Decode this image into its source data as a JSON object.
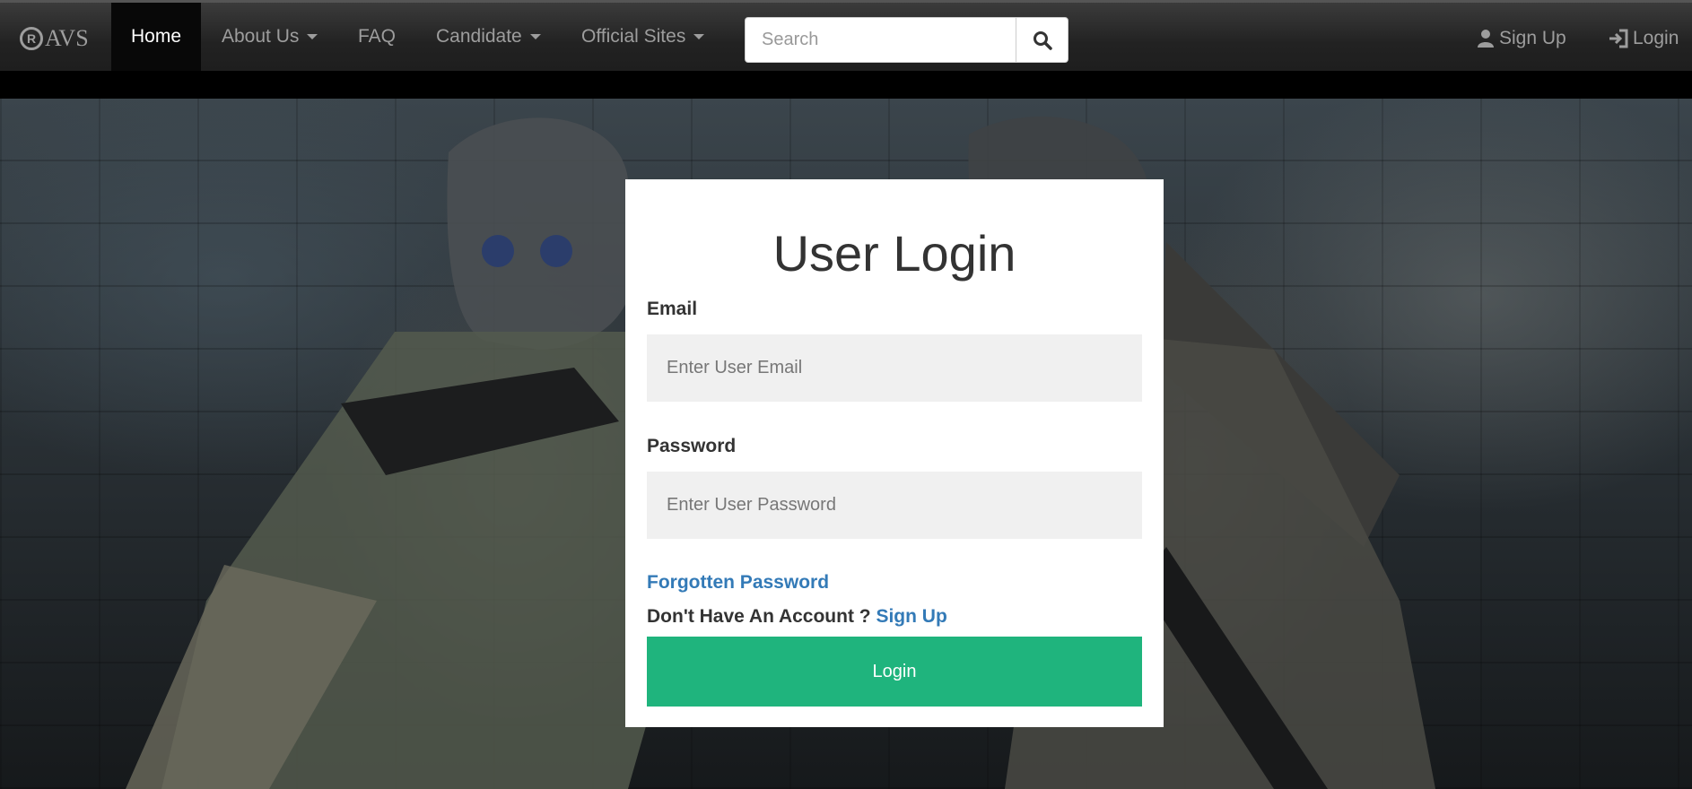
{
  "brand": {
    "mark": "R",
    "name": "AVS"
  },
  "nav": {
    "home": "Home",
    "about": "About Us",
    "faq": "FAQ",
    "candidate": "Candidate",
    "official": "Official Sites",
    "search_placeholder": "Search",
    "signup": "Sign Up",
    "login": "Login"
  },
  "form": {
    "title": "User Login",
    "email_label": "Email",
    "email_placeholder": "Enter User Email",
    "password_label": "Password",
    "password_placeholder": "Enter User Password",
    "forgot": "Forgotten Password",
    "no_account": "Don't Have An Account ?",
    "signup_link": "Sign Up",
    "submit": "Login"
  },
  "colors": {
    "navbar": "#222222",
    "accent_link": "#337ab7",
    "login_button": "#1fb47d"
  }
}
